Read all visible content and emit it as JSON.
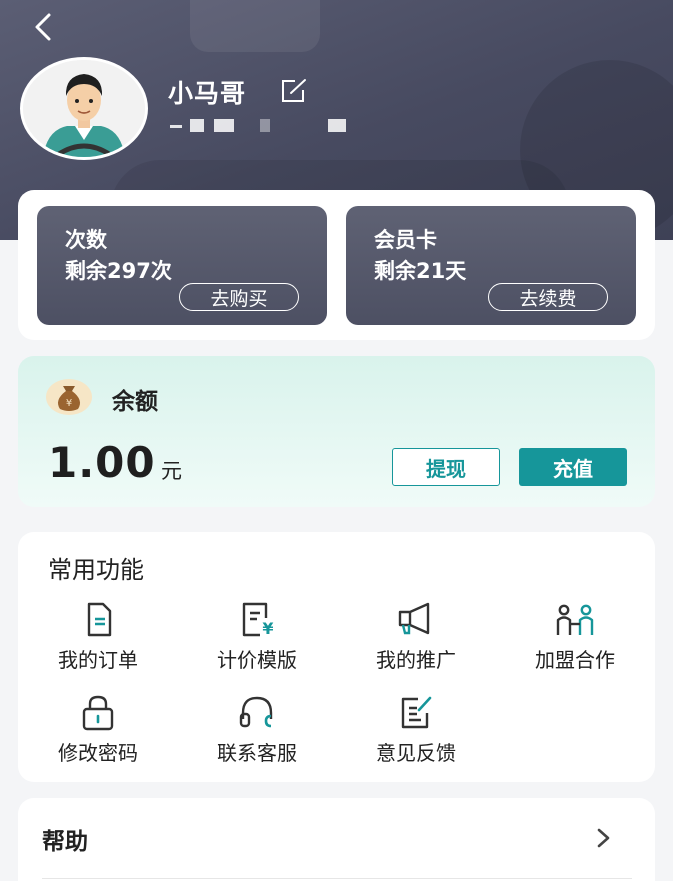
{
  "profile": {
    "username": "小马哥"
  },
  "stats": [
    {
      "title": "次数",
      "value": "剩余297次",
      "button": "去购买"
    },
    {
      "title": "会员卡",
      "value": "剩余21天",
      "button": "去续费"
    }
  ],
  "balance": {
    "label": "余额",
    "amount": "1.00",
    "unit": "元",
    "withdraw_label": "提现",
    "recharge_label": "充值"
  },
  "features": {
    "title": "常用功能",
    "items": [
      {
        "label": "我的订单",
        "icon": "order-doc-icon"
      },
      {
        "label": "计价模版",
        "icon": "pricing-template-icon"
      },
      {
        "label": "我的推广",
        "icon": "megaphone-icon"
      },
      {
        "label": "加盟合作",
        "icon": "partnership-icon"
      },
      {
        "label": "修改密码",
        "icon": "lock-icon"
      },
      {
        "label": "联系客服",
        "icon": "headset-icon"
      },
      {
        "label": "意见反馈",
        "icon": "feedback-edit-icon"
      }
    ]
  },
  "help": {
    "label": "帮助"
  },
  "colors": {
    "accent": "#16969a",
    "header": "#4a4d63",
    "stat_card": "#575a6c",
    "balance_bg": "#dff5ef"
  }
}
